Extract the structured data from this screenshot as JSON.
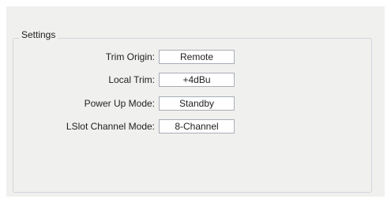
{
  "settings": {
    "group_title": "Settings",
    "rows": [
      {
        "label": "Trim Origin:",
        "value": "Remote"
      },
      {
        "label": "Local Trim:",
        "value": "+4dBu"
      },
      {
        "label": "Power Up Mode:",
        "value": "Standby"
      },
      {
        "label": "LSlot Channel Mode:",
        "value": "8-Channel"
      }
    ]
  },
  "colors": {
    "panel_background": "#f0f0ee",
    "group_border": "#d2d6db",
    "field_border": "#a7aeb6",
    "field_background": "#ffffff"
  }
}
